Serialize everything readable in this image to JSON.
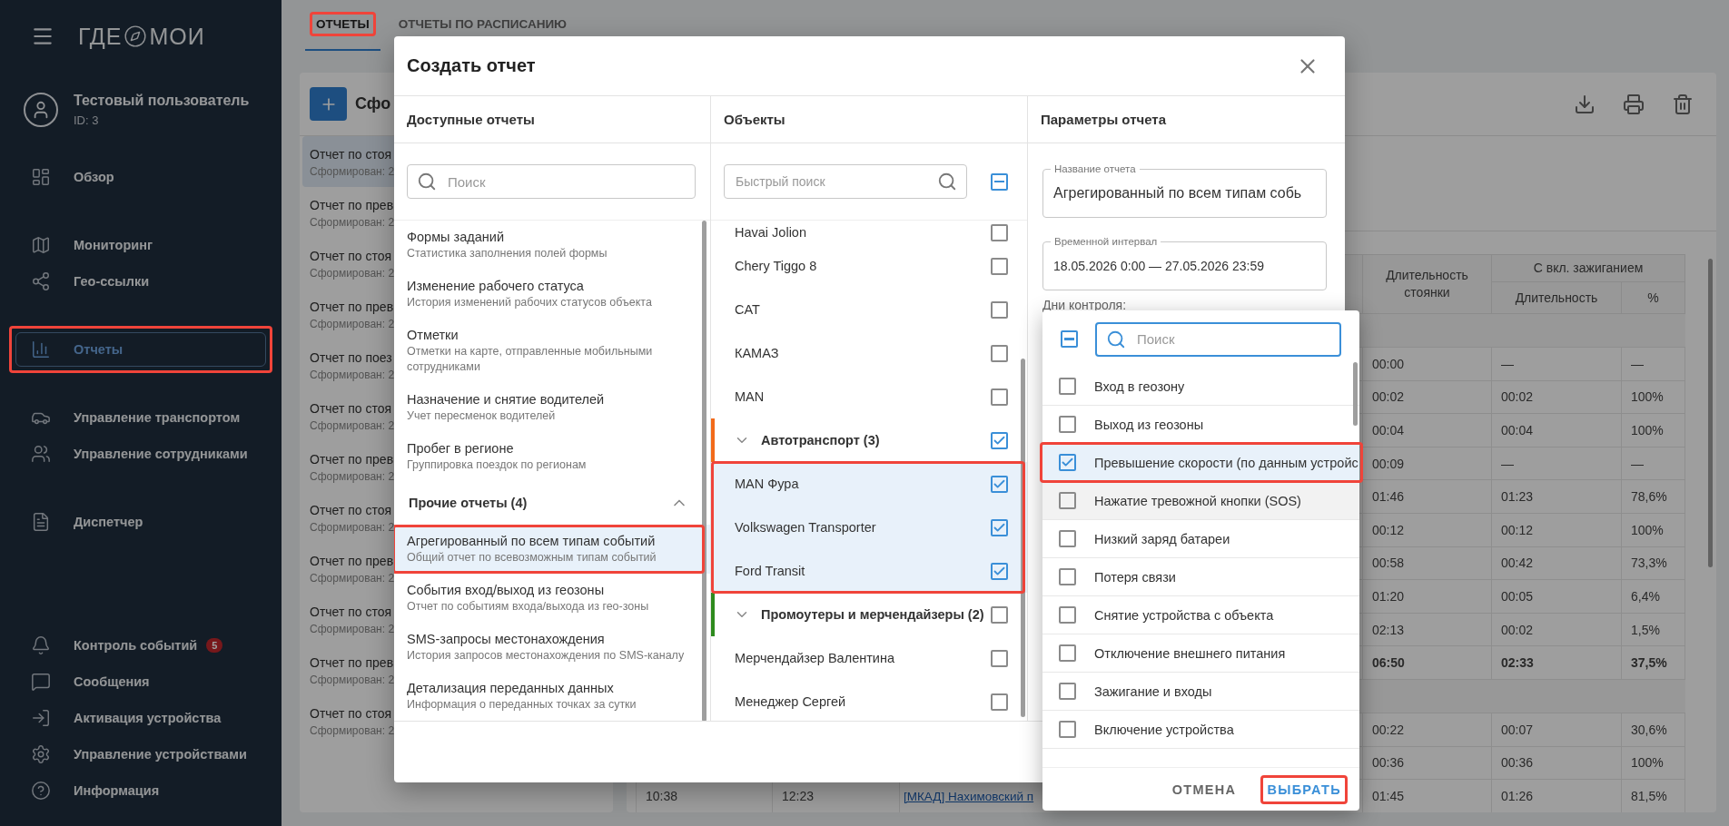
{
  "sidebar": {
    "logo": [
      "ГДЕ",
      "МОИ"
    ],
    "user": {
      "name": "Тестовый пользователь",
      "id": "ID: 3"
    },
    "sections": [
      {
        "items": [
          {
            "label": "Обзор",
            "selected": false,
            "highlighted": false
          }
        ]
      },
      {
        "items": [
          {
            "label": "Мониторинг",
            "selected": false,
            "highlighted": false
          },
          {
            "label": "Гео-ссылки",
            "selected": false,
            "highlighted": false
          }
        ]
      },
      {
        "items": [
          {
            "label": "Отчеты",
            "selected": true,
            "highlighted": true
          }
        ]
      },
      {
        "items": [
          {
            "label": "Управление транспортом",
            "selected": false,
            "highlighted": false
          },
          {
            "label": "Управление сотрудниками",
            "selected": false,
            "highlighted": false
          }
        ]
      },
      {
        "items": [
          {
            "label": "Диспетчер",
            "selected": false,
            "highlighted": false
          }
        ]
      },
      {
        "items": [
          {
            "label": "Контроль событий",
            "badge": "5",
            "selected": false,
            "highlighted": false
          },
          {
            "label": "Сообщения",
            "selected": false,
            "highlighted": false
          },
          {
            "label": "Активация устройства",
            "selected": false,
            "highlighted": false
          },
          {
            "label": "Управление устройствами",
            "selected": false,
            "highlighted": false
          },
          {
            "label": "Информация",
            "selected": false,
            "highlighted": false
          }
        ]
      }
    ]
  },
  "tabs": [
    {
      "label": "ОТЧЕТЫ",
      "selected": true,
      "highlighted": true
    },
    {
      "label": "ОТЧЕТЫ ПО РАСПИСАНИЮ",
      "selected": false,
      "highlighted": false
    }
  ],
  "reports_panel": {
    "title": "Сфо",
    "items": [
      {
        "title": "Отчет по стоя",
        "subtitle": "Сформирован: 2",
        "selected": true
      },
      {
        "title": "Отчет по прев",
        "subtitle": "Сформирован: 2",
        "selected": false
      },
      {
        "title": "Отчет по стоя",
        "subtitle": "Сформирован: 2",
        "selected": false
      },
      {
        "title": "Отчет по прев",
        "subtitle": "Сформирован: 2",
        "selected": false
      },
      {
        "title": "Отчет по поез",
        "subtitle": "Сформирован: 2",
        "selected": false
      },
      {
        "title": "Отчет по стоя",
        "subtitle": "Сформирован: 2",
        "selected": false
      },
      {
        "title": "Отчет по прев",
        "subtitle": "Сформирован: 2",
        "selected": false
      },
      {
        "title": "Отчет по стоя",
        "subtitle": "Сформирован: 2",
        "selected": false
      },
      {
        "title": "Отчет по прев",
        "subtitle": "Сформирован: 2",
        "selected": false
      },
      {
        "title": "Отчет по стоя",
        "subtitle": "Сформирован: 2",
        "selected": false
      },
      {
        "title": "Отчет по прев",
        "subtitle": "Сформирован: 2",
        "selected": false
      },
      {
        "title": "Отчет по стоя",
        "subtitle": "Сформирован: 2",
        "selected": false
      }
    ]
  },
  "report_view": {
    "table": {
      "parking_header": "Длительность стоянки",
      "ignition_header": "С вкл. зажиганием",
      "ignition_subheaders": [
        "Длительность",
        "%"
      ],
      "rows": [
        {
          "kind": "group"
        },
        {
          "kind": "data",
          "parking": "00:00",
          "ign_duration": "—",
          "ign_share": "—"
        },
        {
          "kind": "data",
          "parking": "00:02",
          "ign_duration": "00:02",
          "ign_share": "100%"
        },
        {
          "kind": "data",
          "parking": "00:04",
          "ign_duration": "00:04",
          "ign_share": "100%"
        },
        {
          "kind": "data",
          "parking": "00:09",
          "ign_duration": "—",
          "ign_share": "—"
        },
        {
          "kind": "data",
          "parking": "01:46",
          "ign_duration": "01:23",
          "ign_share": "78,6%"
        },
        {
          "kind": "data",
          "parking": "00:12",
          "ign_duration": "00:12",
          "ign_share": "100%"
        },
        {
          "kind": "data",
          "parking": "00:58",
          "ign_duration": "00:42",
          "ign_share": "73,3%"
        },
        {
          "kind": "data",
          "parking": "01:20",
          "ign_duration": "00:05",
          "ign_share": "6,4%"
        },
        {
          "kind": "data",
          "parking": "02:13",
          "ign_duration": "00:02",
          "ign_share": "1,5%"
        },
        {
          "kind": "total",
          "parking": "06:50",
          "ign_duration": "02:33",
          "ign_share": "37,5%"
        },
        {
          "kind": "group"
        },
        {
          "kind": "data",
          "parking": "00:22",
          "ign_duration": "00:07",
          "ign_share": "30,6%"
        },
        {
          "kind": "data",
          "parking": "00:36",
          "ign_duration": "00:36",
          "ign_share": "100%"
        },
        {
          "kind": "data",
          "start": "10:38",
          "end": "12:23",
          "address": "[МКАД] Нахимовский п",
          "parking": "01:45",
          "ign_duration": "01:26",
          "ign_share": "81,5%"
        }
      ]
    }
  },
  "dialog": {
    "title": "Создать отчет",
    "available_reports": {
      "heading": "Доступные отчеты",
      "search_placeholder": "Поиск",
      "items": [
        {
          "kind": "report",
          "title": "Формы заданий",
          "subtitle": "Статистика заполнения полей формы",
          "selected": false,
          "highlighted": false
        },
        {
          "kind": "report",
          "title": "Изменение рабочего статуса",
          "subtitle": "История изменений рабочих статусов объекта",
          "selected": false,
          "highlighted": false
        },
        {
          "kind": "report",
          "title": "Отметки",
          "subtitle": "Отметки на карте, отправленные мобильными сотрудниками",
          "selected": false,
          "highlighted": false
        },
        {
          "kind": "report",
          "title": "Назначение и снятие водителей",
          "subtitle": "Учет пересменок водителей",
          "selected": false,
          "highlighted": false
        },
        {
          "kind": "report",
          "title": "Пробег в регионе",
          "subtitle": "Группировка поездок по регионам",
          "selected": false,
          "highlighted": false
        },
        {
          "kind": "section",
          "title": "Прочие отчеты (4)",
          "expanded": true
        },
        {
          "kind": "report",
          "title": "Агрегированный по всем типам событий",
          "subtitle": "Общий отчет по всевозможным типам событий",
          "selected": true,
          "highlighted": true
        },
        {
          "kind": "report",
          "title": "События вход/выход из геозоны",
          "subtitle": "Отчет по событиям входа/выхода из гео-зоны",
          "selected": false,
          "highlighted": false
        },
        {
          "kind": "report",
          "title": "SMS-запросы местонахождения",
          "subtitle": "История запросов местонахождения по SMS-каналу",
          "selected": false,
          "highlighted": false
        },
        {
          "kind": "report",
          "title": "Детализация переданных данных",
          "subtitle": "Информация о переданных точках за сутки",
          "selected": false,
          "highlighted": false
        }
      ]
    },
    "objects": {
      "heading": "Объекты",
      "search_placeholder": "Быстрый поиск",
      "select_all": {
        "indeterminate": true
      },
      "items": [
        {
          "kind": "object",
          "name": "Havai Jolion",
          "checked": false
        },
        {
          "kind": "object",
          "name": "Chery Tiggo 8",
          "checked": false
        },
        {
          "kind": "object",
          "name": "CAT",
          "checked": false
        },
        {
          "kind": "object",
          "name": "КАМАЗ",
          "checked": false
        },
        {
          "kind": "object",
          "name": "MAN",
          "checked": false
        },
        {
          "kind": "group",
          "name": "Автотранспорт (3)",
          "checked": true,
          "expanded": true,
          "color": "#f26a1b",
          "highlighted": true,
          "children": [
            {
              "kind": "object",
              "name": "MAN Фура",
              "checked": true
            },
            {
              "kind": "object",
              "name": "Volkswagen Transporter",
              "checked": true
            },
            {
              "kind": "object",
              "name": "Ford Transit",
              "checked": true
            }
          ]
        },
        {
          "kind": "group",
          "name": "Промоутеры и мерчендайзеры (2)",
          "checked": false,
          "expanded": true,
          "color": "#2e8b1e",
          "highlighted": false,
          "children": [
            {
              "kind": "object",
              "name": "Мерчендайзер Валентина",
              "checked": false
            },
            {
              "kind": "object",
              "name": "Менеджер Сергей",
              "checked": false
            }
          ]
        }
      ]
    },
    "parameters": {
      "heading": "Параметры отчета",
      "fields": [
        {
          "label": "Название отчета",
          "value": "Агрегированный по всем типам собь"
        },
        {
          "label": "Временной интервал",
          "value": "18.05.2026 0:00 — 27.05.2026 23:59"
        }
      ],
      "control_days_label": "Дни контроля:"
    }
  },
  "event_picker": {
    "select_all": {
      "indeterminate": true
    },
    "search_placeholder": "Поиск",
    "focused": true,
    "options": [
      {
        "label": "Вход в геозону",
        "checked": false,
        "hovered": false,
        "highlighted": false
      },
      {
        "label": "Выход из геозоны",
        "checked": false,
        "hovered": false,
        "highlighted": false
      },
      {
        "label": "Превышение скорости (по данным устройс",
        "checked": true,
        "hovered": false,
        "highlighted": true
      },
      {
        "label": "Нажатие тревожной кнопки (SOS)",
        "checked": false,
        "hovered": true,
        "highlighted": false
      },
      {
        "label": "Низкий заряд батареи",
        "checked": false,
        "hovered": false,
        "highlighted": false
      },
      {
        "label": "Потеря связи",
        "checked": false,
        "hovered": false,
        "highlighted": false
      },
      {
        "label": "Снятие устройства с объекта",
        "checked": false,
        "hovered": false,
        "highlighted": false
      },
      {
        "label": "Отключение внешнего питания",
        "checked": false,
        "hovered": false,
        "highlighted": false
      },
      {
        "label": "Зажигание и входы",
        "checked": false,
        "hovered": false,
        "highlighted": false
      },
      {
        "label": "Включение устройства",
        "checked": false,
        "hovered": false,
        "highlighted": false
      }
    ],
    "buttons": [
      {
        "label": "ОТМЕНА",
        "kind": "cancel",
        "highlighted": false
      },
      {
        "label": "ВЫБРАТЬ",
        "kind": "confirm",
        "highlighted": true
      }
    ]
  }
}
